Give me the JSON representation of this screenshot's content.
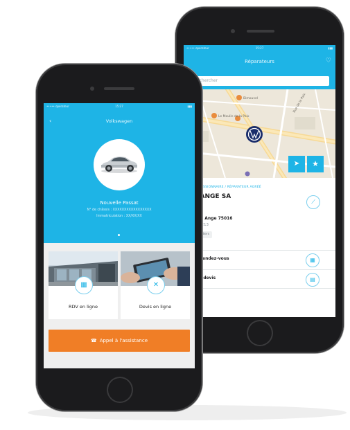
{
  "back_screen": {
    "status": {
      "carrier": "••••• operateur",
      "time": "15:27",
      "battery": "▮▮▮"
    },
    "header": {
      "title": "Réparateurs",
      "fav_icon": "heart-star-icon"
    },
    "search": {
      "placeholder": "Rechercher"
    },
    "map": {
      "labels": [
        "Bimouvel",
        "Le Moulin de la Paix",
        "Rue de la Paix"
      ],
      "pin_icon": "vw-logo-icon"
    },
    "dealer": {
      "category": "CONCESSIONNAIRE / RÉPARATEUR AGRÉÉ",
      "name": "HEL ANGE SA",
      "address": "e Michel Ange 75016",
      "phone": "0140712213",
      "tag": "Les Amandiers"
    },
    "actions": [
      {
        "label": "dre un rendez-vous",
        "icon": "calendar-icon"
      },
      {
        "label": "nder un devis",
        "icon": "document-icon"
      }
    ]
  },
  "front_screen": {
    "status": {
      "carrier": "••••• operateur",
      "time": "15:27",
      "battery": "▮▮▮"
    },
    "header": {
      "title": "Volkswagen"
    },
    "vehicle": {
      "model": "Nouvelle Passat",
      "vin": "N° de châssis : XXXXXXXXXXXXXXXXX",
      "date": "Immatriculation : XX/XX/XX"
    },
    "tiles": [
      {
        "label": "RDV en ligne",
        "icon": "calendar-icon"
      },
      {
        "label": "Devis en ligne",
        "icon": "tools-icon"
      }
    ],
    "assistance": {
      "label": "Appel à l'assistance",
      "icon": "car-phone-icon"
    }
  },
  "colors": {
    "brand_blue": "#1eb4e6",
    "accent_orange": "#f07e26"
  }
}
